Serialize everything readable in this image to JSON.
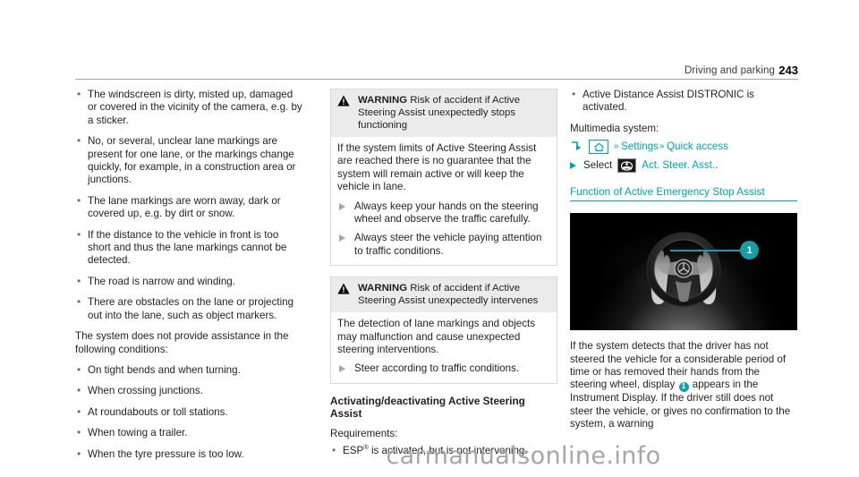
{
  "header": {
    "section_title": "Driving and parking",
    "page_number": "243"
  },
  "left_column": {
    "limits_bullets": [
      "The windscreen is dirty, misted up, damaged or covered in the vicinity of the camera, e.g. by a sticker.",
      "No, or several, unclear lane markings are present for one lane, or the markings change quickly, for example, in a construction area or junctions.",
      "The lane markings are worn away, dark or covered up, e.g. by dirt or snow.",
      "If the distance to the vehicle in front is too short and thus the lane markings cannot be detected.",
      "The road is narrow and winding.",
      "There are obstacles on the lane or projecting out into the lane, such as object markers."
    ],
    "no_assistance_intro": "The system does not provide assistance in the following conditions:",
    "no_assistance_bullets": [
      "On tight bends and when turning.",
      "When crossing junctions.",
      "At roundabouts or toll stations.",
      "When towing a trailer.",
      "When the tyre pressure is too low."
    ]
  },
  "middle_column": {
    "warning_1": {
      "label": "WARNING",
      "title": "Risk of accident if Active Steering Assist unexpectedly stops functioning",
      "body": "If the system limits of Active Steering Assist are reached there is no guarantee that the system will remain active or will keep the vehicle in lane.",
      "actions": [
        "Always keep your hands on the steering wheel and observe the traffic carefully.",
        "Always steer the vehicle paying attention to traffic conditions."
      ]
    },
    "warning_2": {
      "label": "WARNING",
      "title": "Risk of accident if Active Steering Assist unexpectedly intervenes",
      "body": "The detection of lane markings and objects may malfunction and cause unexpected steering interventions.",
      "actions": [
        "Steer according to traffic conditions."
      ]
    },
    "activating_heading": "Activating/deactivating Active Steering Assist",
    "requirements_label": "Requirements:",
    "requirements": [
      {
        "prefix": "ESP",
        "sup": "®",
        "rest": " is activated, but is not intervening."
      }
    ]
  },
  "right_column": {
    "requirement_bullets": [
      "Active Distance Assist DISTRONIC is activated."
    ],
    "multimedia_label": "Multimedia system:",
    "nav_path": {
      "hook_icon": "corner-arrow-icon",
      "home_icon": "home-icon",
      "steps": [
        "Settings",
        "Quick access"
      ],
      "chevron": "»"
    },
    "select_row": {
      "verb": "Select",
      "icon": "steering-wheel-icon",
      "target": "Act. Steer. Asst.",
      "terminator": "."
    },
    "section_heading": "Function of Active Emergency Stop Assist",
    "figure": {
      "caption_number": "1",
      "alt": "steering wheel with driver hands illustration"
    },
    "body_before_badge": "If the system detects that the driver has not steered the vehicle for a considerable period of time or has removed their hands from the steering wheel, display",
    "badge_number": "1",
    "body_after_badge": "appears in the Instrument Display. If the driver still does not steer the vehicle, or gives no confirmation to the system, a warning"
  },
  "watermark": "carmanualsonline.info",
  "colors": {
    "accent_teal": "#00a2ac",
    "callout_teal": "#1a9ba5",
    "warning_header_bg": "#ebebeb",
    "rule": "#9aa8a8",
    "text": "#231f20"
  }
}
